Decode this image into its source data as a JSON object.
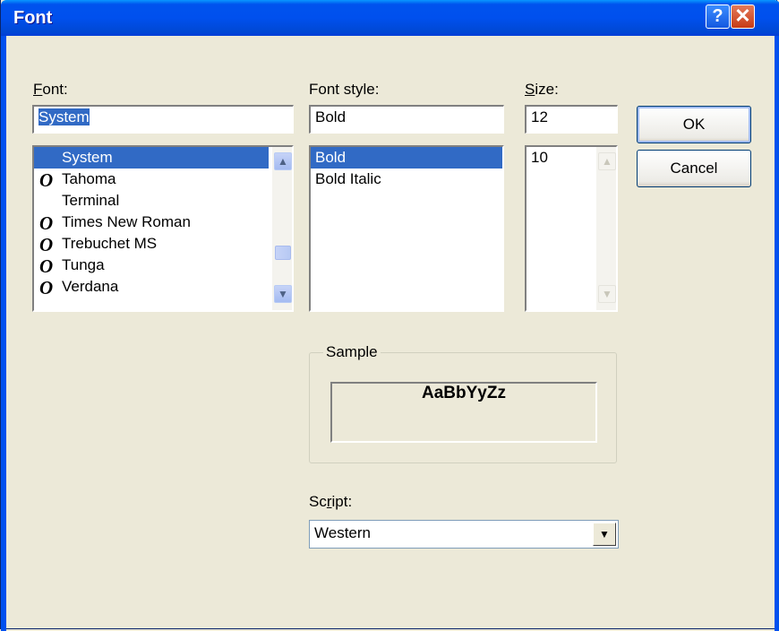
{
  "window": {
    "title": "Font",
    "help_label": "?",
    "close_label": "✕"
  },
  "font": {
    "label_ul": "F",
    "label_rest": "ont:",
    "value": "System",
    "items": [
      {
        "name": "System",
        "icon": "",
        "selected": true
      },
      {
        "name": "Tahoma",
        "icon": "O"
      },
      {
        "name": "Terminal",
        "icon": ""
      },
      {
        "name": "Times New Roman",
        "icon": "O"
      },
      {
        "name": "Trebuchet MS",
        "icon": "O"
      },
      {
        "name": "Tunga",
        "icon": "O"
      },
      {
        "name": "Verdana",
        "icon": "O"
      }
    ]
  },
  "style": {
    "label_ul": "",
    "label": "Font style:",
    "value": "Bold",
    "items": [
      "Bold",
      "Bold Italic"
    ]
  },
  "size": {
    "label_ul": "S",
    "label_rest": "ize:",
    "value": "12",
    "items": [
      "10"
    ]
  },
  "buttons": {
    "ok": "OK",
    "cancel": "Cancel"
  },
  "sample": {
    "label": "Sample",
    "text": "AaBbYyZz"
  },
  "script": {
    "label_pre": "Sc",
    "label_ul": "r",
    "label_post": "ipt:",
    "value": "Western"
  },
  "icons": {
    "up": "▲",
    "down": "▼",
    "combo": "▼"
  },
  "colors": {
    "titlebar": "#0050ee",
    "selection": "#316ac5",
    "face": "#ece9d8"
  }
}
